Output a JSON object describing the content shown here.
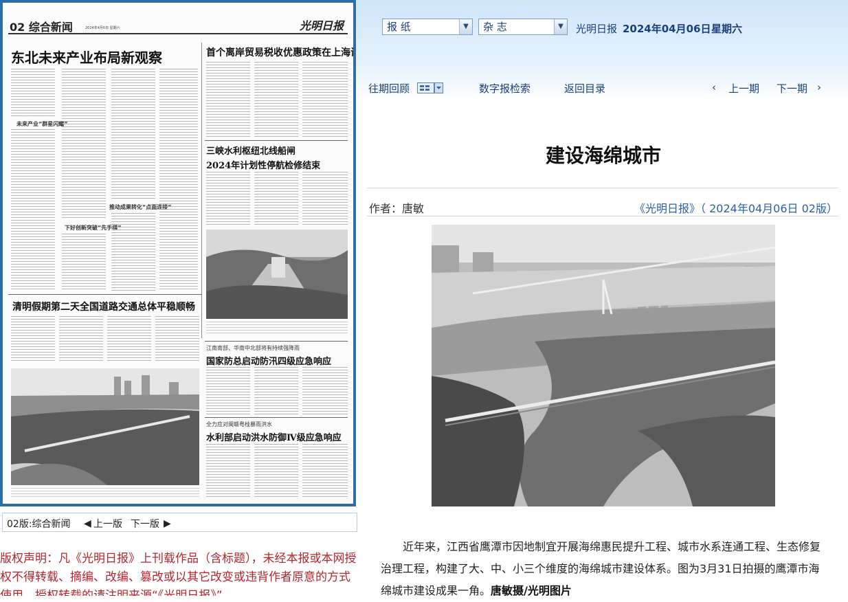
{
  "paper": {
    "page_label": "02 综合新闻",
    "date_line": "2024年4月6日 星期六",
    "logo": "光明日报",
    "headlines": {
      "h1": "东北未来产业布局新观察",
      "h2": "首个离岸贸易税收优惠政策在上海试点",
      "h3": "三峡水利枢纽北线船闸",
      "h3b": "2024年计划性停航检修结束",
      "h4": "清明假期第二天全国道路交通总体平稳顺畅",
      "h5pre": "江南南部、华南中北部将有持续强降雨",
      "h5": "国家防总启动防汛四级应急响应",
      "h6pre": "全力应对闽赣粤桂暴雨洪水",
      "h6": "水利部启动洪水防御Ⅳ级应急响应",
      "s1": "未来产业“群星闪耀”",
      "s2": "下好创新突破“先手棋”",
      "s3": "推动成果转化“点面连接”"
    }
  },
  "header": {
    "select_newspaper": "报 纸",
    "select_magazine": "杂 志",
    "paper_name": "光明日报",
    "date": "2024年04月06日",
    "weekday": "星期六",
    "nav": {
      "archive": "往期回顾",
      "search": "数字报检索",
      "back": "返回目录",
      "prev_arrow": "‹",
      "prev": "上一期",
      "next": "下一期",
      "next_arrow": "›"
    }
  },
  "article": {
    "title": "建设海绵城市",
    "author": "作者：唐敏",
    "source": "《光明日报》（ 2024年04月06日  02版）",
    "body": "近年来，江西省鹰潭市因地制宜开展海绵惠民提升工程、城市水系连通工程、生态修复治理工程，构建了大、中、小三个维度的海绵城市建设体系。图为3月31日拍摄的鹰潭市海绵城市建设成果一角。",
    "credit": "唐敏摄/光明图片"
  },
  "pager": {
    "current": "02版:综合新闻",
    "prev": "上一版",
    "next": "下一版"
  },
  "copyright": "版权声明：凡《光明日报》上刊载作品（含标题），未经本报或本网授权不得转载、摘编、改编、篡改或以其它改变或违背作者原意的方式使用。授权转载的请注明来源“《光明日报》”。"
}
